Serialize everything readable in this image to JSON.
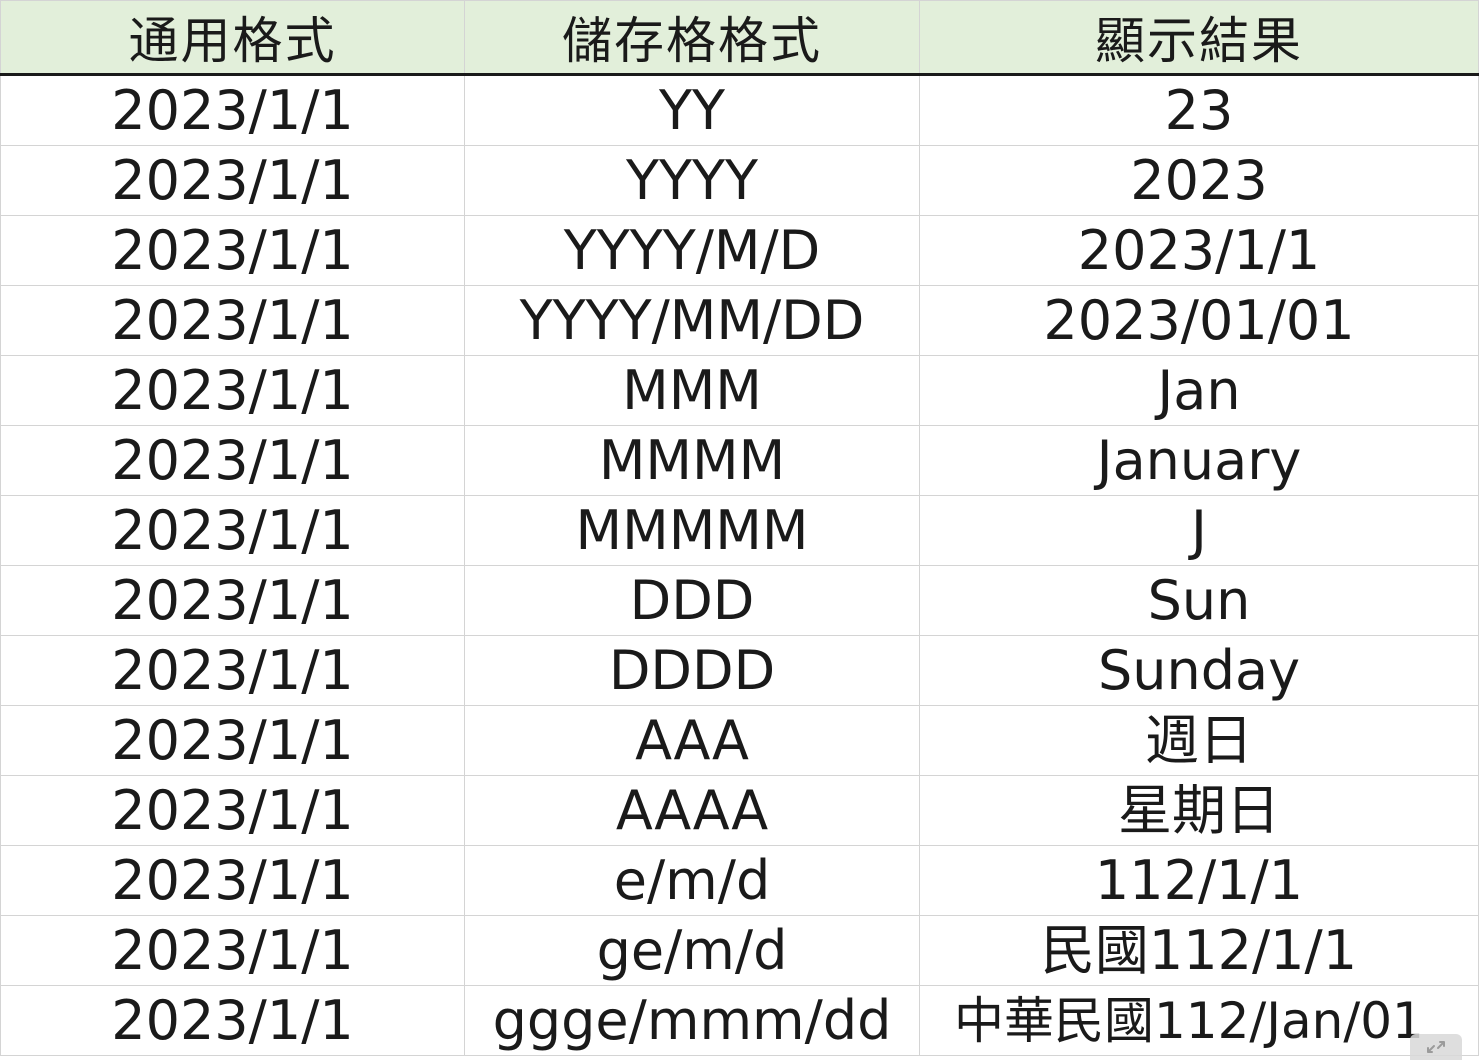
{
  "table": {
    "headers": [
      "通用格式",
      "儲存格格式",
      "顯示結果"
    ],
    "rows": [
      [
        "2023/1/1",
        "YY",
        "23"
      ],
      [
        "2023/1/1",
        "YYYY",
        "2023"
      ],
      [
        "2023/1/1",
        "YYYY/M/D",
        "2023/1/1"
      ],
      [
        "2023/1/1",
        "YYYY/MM/DD",
        "2023/01/01"
      ],
      [
        "2023/1/1",
        "MMM",
        "Jan"
      ],
      [
        "2023/1/1",
        "MMMM",
        "January"
      ],
      [
        "2023/1/1",
        "MMMMM",
        "J"
      ],
      [
        "2023/1/1",
        "DDD",
        "Sun"
      ],
      [
        "2023/1/1",
        "DDDD",
        "Sunday"
      ],
      [
        "2023/1/1",
        "AAA",
        "週日"
      ],
      [
        "2023/1/1",
        "AAAA",
        "星期日"
      ],
      [
        "2023/1/1",
        "e/m/d",
        "112/1/1"
      ],
      [
        "2023/1/1",
        "ge/m/d",
        "民國112/1/1"
      ],
      [
        "2023/1/1",
        "ggge/mmm/dd",
        "中華民國112/Jan/01"
      ]
    ]
  },
  "colors": {
    "header_background": "#e2efda",
    "grid_line": "#d4d4d4",
    "text": "#1a1a1a"
  },
  "icons": {
    "corner": "expand-icon"
  }
}
